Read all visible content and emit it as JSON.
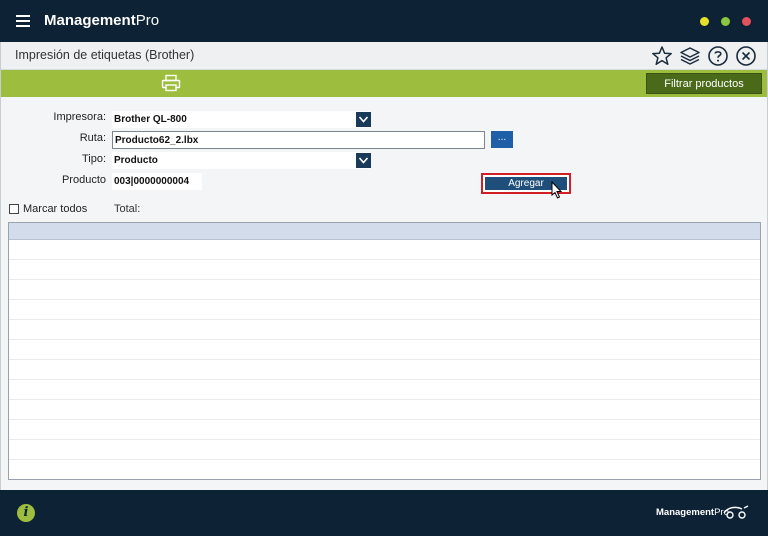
{
  "app": {
    "title_bold": "Management",
    "title_rest": "Pro",
    "window_buttons": [
      {
        "name": "minimize-dot",
        "color": "#e5e02a"
      },
      {
        "name": "maximize-dot",
        "color": "#8cc63f"
      },
      {
        "name": "close-dot",
        "color": "#e2525c"
      }
    ]
  },
  "header": {
    "page_title": "Impresión de etiquetas (Brother)",
    "icons": [
      "star-icon",
      "layers-icon",
      "help-icon",
      "close-circle-icon"
    ]
  },
  "toolbar": {
    "print_icon": "printer-icon",
    "filter_label": "Filtrar productos"
  },
  "form": {
    "printer_label": "Impresora:",
    "printer_value": "Brother QL-800",
    "path_label": "Ruta:",
    "path_value": "Producto62_2.lbx",
    "browse_label": "...",
    "type_label": "Tipo:",
    "type_value": "Producto",
    "product_label": "Producto",
    "product_value": "003|0000000004",
    "add_label": "Agregar"
  },
  "list": {
    "select_all_label": "Marcar todos",
    "total_label": "Total:",
    "select_all_checked": false
  },
  "footer": {
    "info_icon": "info-icon",
    "brand_bold": "Management",
    "brand_rest": "Pro"
  }
}
